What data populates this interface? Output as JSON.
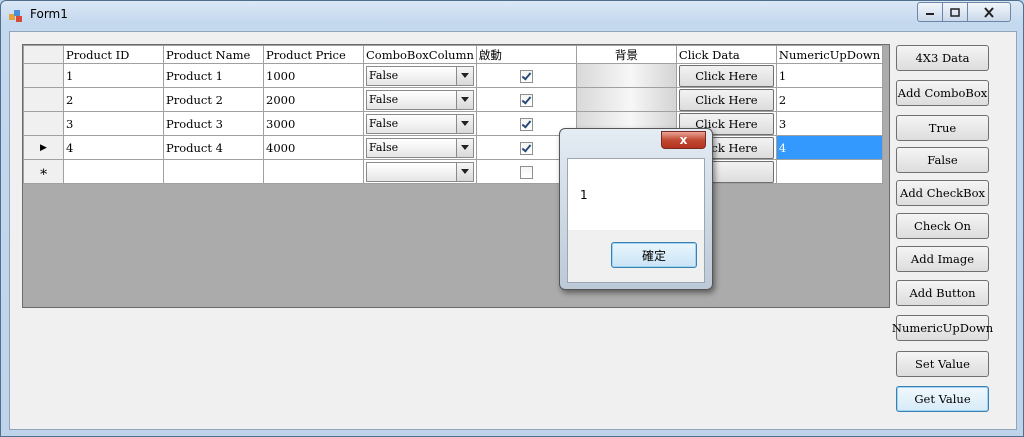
{
  "window": {
    "title": "Form1"
  },
  "grid": {
    "columns": [
      "Product ID",
      "Product Name",
      "Product Price",
      "ComboBoxColumn",
      "啟動",
      "背景",
      "Click Data",
      "NumericUpDown"
    ],
    "rows": [
      {
        "id": "1",
        "name": "Product 1",
        "price": "1000",
        "combo": "False",
        "checked": true,
        "button": "Click Here",
        "numeric": "1"
      },
      {
        "id": "2",
        "name": "Product 2",
        "price": "2000",
        "combo": "False",
        "checked": true,
        "button": "Click Here",
        "numeric": "2"
      },
      {
        "id": "3",
        "name": "Product 3",
        "price": "3000",
        "combo": "False",
        "checked": true,
        "button": "Click Here",
        "numeric": "3"
      },
      {
        "id": "4",
        "name": "Product 4",
        "price": "4000",
        "combo": "False",
        "checked": true,
        "button": "Click Here",
        "numeric": "4"
      }
    ],
    "new_row_marker": "∗",
    "current_row_marker": "▶"
  },
  "buttons": [
    "4X3 Data",
    "Add ComboBox",
    "True",
    "False",
    "Add CheckBox",
    "Check On",
    "Add Image",
    "Add Button",
    "NumericUpDown",
    "Set Value",
    "Get Value"
  ],
  "dialog": {
    "message": "1",
    "ok_label": "確定",
    "close_glyph": "x"
  }
}
